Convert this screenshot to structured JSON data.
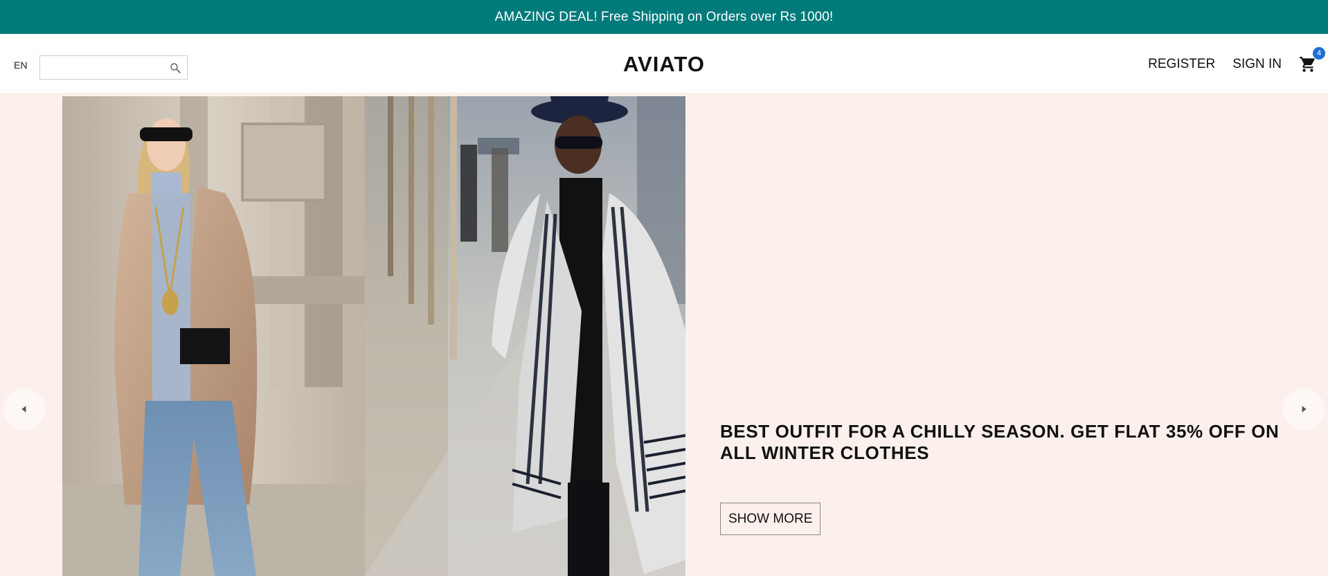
{
  "promo": {
    "text": "AMAZING DEAL! Free Shipping on Orders over Rs 1000!"
  },
  "header": {
    "language": "EN",
    "search": {
      "value": "",
      "placeholder": ""
    },
    "logo": "AVIATO",
    "register_label": "REGISTER",
    "signin_label": "SIGN IN",
    "cart_count": "4"
  },
  "hero": {
    "title": "BEST OUTFIT FOR A CHILLY SEASON. GET FLAT 35% OFF ON ALL WINTER CLOTHES",
    "cta_label": "SHOW MORE",
    "image_icon": "winter-fashion-photo",
    "prev_icon": "caret-left-icon",
    "next_icon": "caret-right-icon"
  },
  "colors": {
    "promo_bg": "#007a7b",
    "hero_bg": "#fbf0ec",
    "badge": "#1d6fd6"
  }
}
